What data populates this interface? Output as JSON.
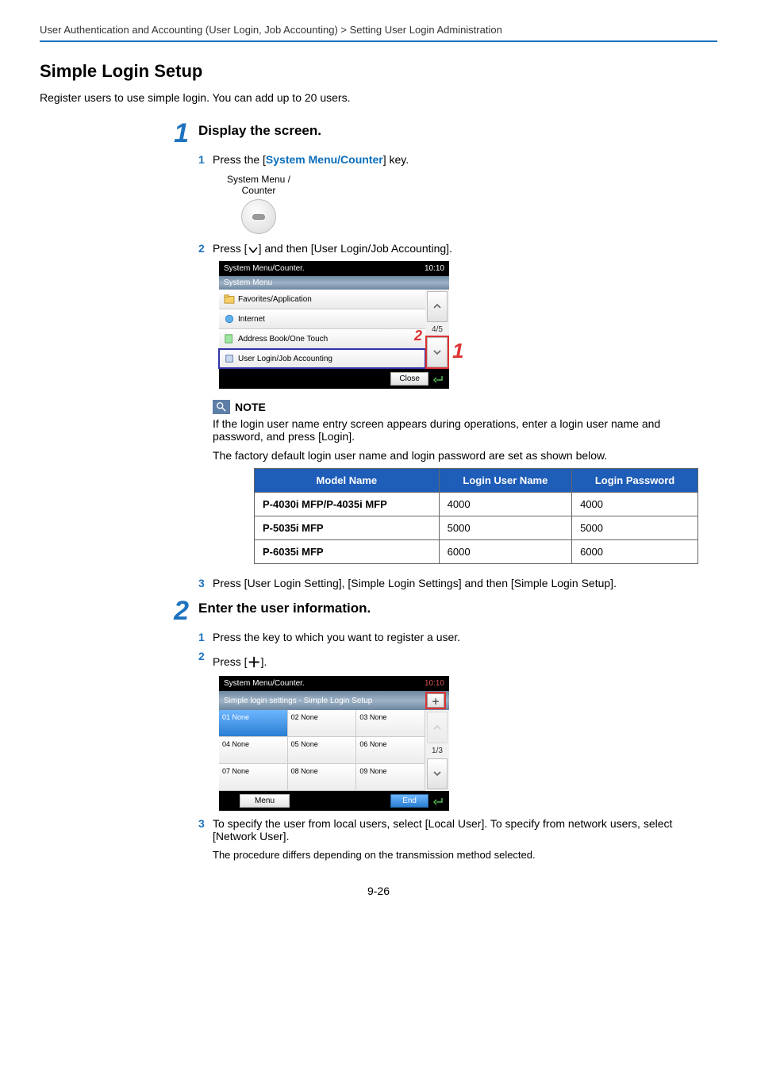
{
  "breadcrumb": "User Authentication and Accounting (User Login, Job Accounting) > Setting User Login Administration",
  "h1": "Simple Login Setup",
  "intro": "Register users to use simple login. You can add up to 20 users.",
  "step1": {
    "num": "1",
    "title": "Display the screen.",
    "sub1": {
      "num": "1",
      "pre": "Press the [",
      "link": "System Menu/Counter",
      "post": "] key."
    },
    "key_label_line1": "System Menu /",
    "key_label_line2": "Counter",
    "sub2": {
      "num": "2",
      "pre": "Press [",
      "post": "] and then [User Login/Job Accounting]."
    },
    "panel1": {
      "top_left": "System Menu/Counter.",
      "top_right": "10:10",
      "bar": "System Menu",
      "items": [
        "Favorites/Application",
        "Internet",
        "Address Book/One Touch",
        "User Login/Job Accounting"
      ],
      "page": "4/5",
      "close": "Close",
      "callouts": {
        "down": "1",
        "addr": "2"
      }
    },
    "note_label": "NOTE",
    "note_p1": "If the login user name entry screen appears during operations, enter a login user name and password, and press [Login].",
    "note_p2": "The factory default login user name and login password are set as shown below.",
    "table": {
      "headers": [
        "Model Name",
        "Login User Name",
        "Login Password"
      ],
      "rows": [
        [
          "P-4030i MFP/P-4035i MFP",
          "4000",
          "4000"
        ],
        [
          "P-5035i MFP",
          "5000",
          "5000"
        ],
        [
          "P-6035i MFP",
          "6000",
          "6000"
        ]
      ]
    },
    "sub3": {
      "num": "3",
      "text": "Press [User Login Setting], [Simple Login Settings] and then [Simple Login Setup]."
    }
  },
  "step2": {
    "num": "2",
    "title": "Enter the user information.",
    "sub1": {
      "num": "1",
      "text": "Press the key to which you want to register a user."
    },
    "sub2": {
      "num": "2",
      "pre": "Press [",
      "post": "]."
    },
    "panel2": {
      "top_left": "System Menu/Counter.",
      "top_right": "10:10",
      "bar": "Simple login settings - Simple Login Setup",
      "cells": [
        [
          "01 None",
          "02 None",
          "03 None"
        ],
        [
          "04 None",
          "05 None",
          "06 None"
        ],
        [
          "07 None",
          "08 None",
          "09 None"
        ]
      ],
      "page": "1/3",
      "menu": "Menu",
      "end": "End"
    },
    "sub3": {
      "num": "3",
      "text": "To specify the user from local users, select [Local User]. To specify from network users, select [Network User]."
    },
    "sub3_tail": "The procedure differs depending on the transmission method selected."
  },
  "page_num": "9-26"
}
